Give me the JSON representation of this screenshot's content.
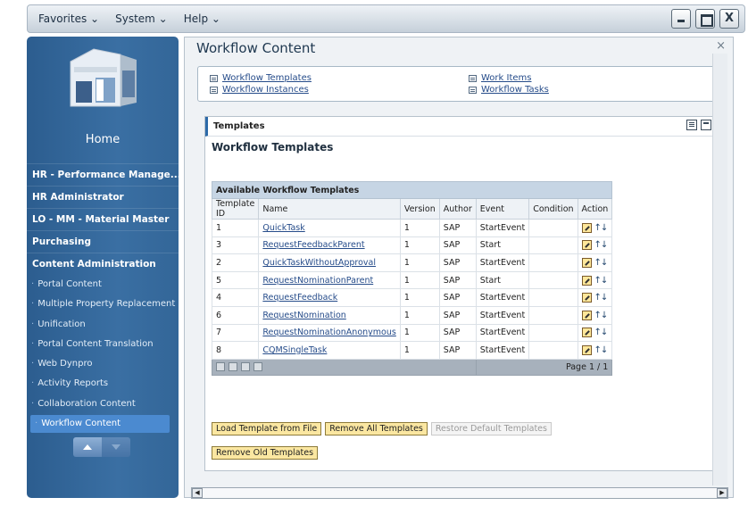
{
  "menu": {
    "favorites": "Favorites",
    "system": "System",
    "help": "Help"
  },
  "sidebar": {
    "home_label": "Home",
    "groups": [
      "HR - Performance Manage...",
      "HR Administrator",
      "LO - MM - Material Master",
      "Purchasing",
      "Content Administration"
    ],
    "items": [
      "Portal Content",
      "Multiple Property Replacement",
      "Unification",
      "Portal Content Translation",
      "Web Dynpro",
      "Activity Reports",
      "Collaboration Content",
      "Workflow Content"
    ]
  },
  "content": {
    "title": "Workflow Content",
    "close": "×",
    "links": {
      "workflow_templates": "Workflow Templates",
      "workflow_instances": "Workflow Instances",
      "work_items": "Work Items",
      "workflow_tasks": "Workflow Tasks"
    },
    "tray_title": "Templates",
    "subtitle": "Workflow Templates",
    "table": {
      "caption": "Available Workflow Templates",
      "headers": [
        "Template ID",
        "Name",
        "Version",
        "Author",
        "Event",
        "Condition",
        "Action"
      ],
      "rows": [
        {
          "id": "1",
          "name": "QuickTask",
          "version": "1",
          "author": "SAP",
          "event": "StartEvent",
          "condition": ""
        },
        {
          "id": "3",
          "name": "RequestFeedbackParent",
          "version": "1",
          "author": "SAP",
          "event": "Start",
          "condition": ""
        },
        {
          "id": "2",
          "name": "QuickTaskWithoutApproval",
          "version": "1",
          "author": "SAP",
          "event": "StartEvent",
          "condition": ""
        },
        {
          "id": "5",
          "name": "RequestNominationParent",
          "version": "1",
          "author": "SAP",
          "event": "Start",
          "condition": ""
        },
        {
          "id": "4",
          "name": "RequestFeedback",
          "version": "1",
          "author": "SAP",
          "event": "StartEvent",
          "condition": ""
        },
        {
          "id": "6",
          "name": "RequestNomination",
          "version": "1",
          "author": "SAP",
          "event": "StartEvent",
          "condition": ""
        },
        {
          "id": "7",
          "name": "RequestNominationAnonymous",
          "version": "1",
          "author": "SAP",
          "event": "StartEvent",
          "condition": ""
        },
        {
          "id": "8",
          "name": "CQMSingleTask",
          "version": "1",
          "author": "SAP",
          "event": "StartEvent",
          "condition": ""
        }
      ],
      "pager": "Page 1 / 1",
      "action_icons": [
        "edit-icon",
        "sort-arrows-icon"
      ]
    },
    "buttons": {
      "load": "Load Template from File",
      "remove_all": "Remove All Templates",
      "restore": "Restore Default Templates",
      "remove_old": "Remove Old Templates"
    }
  },
  "colors": {
    "sidebar": "#336698",
    "active_item": "#4b8ad0",
    "button_bg": "#fbe7a1",
    "link": "#264c8a"
  }
}
